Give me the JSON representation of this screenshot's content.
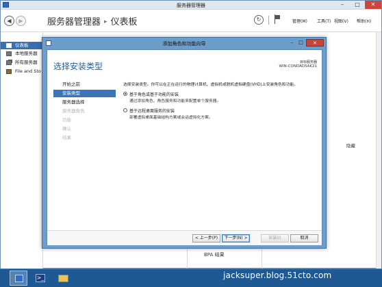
{
  "server_manager": {
    "window_title": "服务器管理器",
    "breadcrumb_root": "服务器管理器",
    "breadcrumb_sep": "▸",
    "breadcrumb_current": "仪表板",
    "menu": {
      "manage": "管理(M)",
      "tools": "工具(T)",
      "view": "视图(V)",
      "help": "帮助(H)"
    },
    "sidebar": [
      {
        "label": "仪表板",
        "icon": "dashboard-icon",
        "active": true
      },
      {
        "label": "本地服务器",
        "icon": "server-icon",
        "active": false
      },
      {
        "label": "所有服务器",
        "icon": "servers-icon",
        "active": false
      },
      {
        "label": "File and Sto",
        "icon": "file-storage-icon",
        "active": false
      }
    ],
    "background": {
      "hide_link": "隐藏",
      "bpa_results": "BPA 结果"
    }
  },
  "wizard": {
    "window_title": "添加角色和功能向导",
    "heading": "选择安装类型",
    "destination_label": "目标服务器",
    "destination_server": "WIN-CONDAD5AK21",
    "steps": [
      {
        "label": "开始之前",
        "state": "normal"
      },
      {
        "label": "安装类型",
        "state": "current"
      },
      {
        "label": "服务器选择",
        "state": "normal"
      },
      {
        "label": "服务器角色",
        "state": "disabled"
      },
      {
        "label": "功能",
        "state": "disabled"
      },
      {
        "label": "确认",
        "state": "disabled"
      },
      {
        "label": "结果",
        "state": "disabled"
      }
    ],
    "description": "选择安装类型。你可以在正在运行的物理计算机、虚拟机或脱机虚拟硬盘(VHD)上安装角色和功能。",
    "options": [
      {
        "label": "基于角色或基于功能的安装",
        "sub": "通过添加角色、角色服务和功能来配置单个服务器。",
        "checked": true
      },
      {
        "label": "基于远程桌面服务的安装",
        "sub": "部署虚拟桌面基础结构方案或会话虚拟化方案。",
        "checked": false
      }
    ],
    "buttons": {
      "previous": "< 上一步(P)",
      "next": "下一步(N) >",
      "install": "安装(I)",
      "cancel": "取消"
    }
  },
  "taskbar": {
    "items": [
      "server-manager-icon",
      "powershell-icon",
      "file-explorer-icon"
    ],
    "watermark": "jacksuper.blog.51cto.com"
  },
  "colors": {
    "accent": "#3a75b8",
    "wizard_frame": "#6c9ec9",
    "heading": "#1f5ea0",
    "close_button": "#c7443a",
    "taskbar": "#1f5994"
  }
}
